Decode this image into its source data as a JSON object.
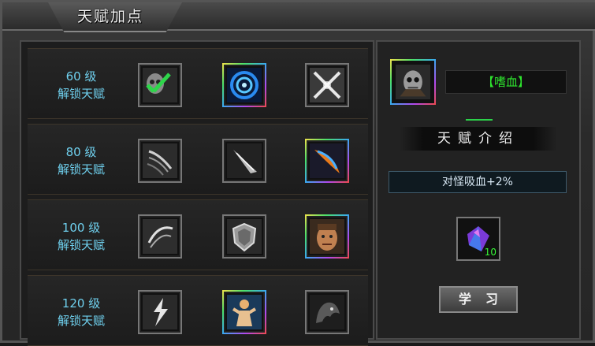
{
  "window": {
    "title": "天赋加点"
  },
  "rows": [
    {
      "line1": "60 级",
      "line2": "解锁天赋",
      "slots": [
        {
          "icon": "skull-checkmark-icon",
          "frame": "gray",
          "selected": true
        },
        {
          "icon": "blue-vortex-icon",
          "frame": "rainbow"
        },
        {
          "icon": "crossed-swords-icon",
          "frame": "gray"
        }
      ]
    },
    {
      "line1": "80 级",
      "line2": "解锁天赋",
      "slots": [
        {
          "icon": "slashing-blade-icon",
          "frame": "gray"
        },
        {
          "icon": "spiked-drill-icon",
          "frame": "gray"
        },
        {
          "icon": "flaming-scimitar-icon",
          "frame": "rainbow"
        }
      ]
    },
    {
      "line1": "100 级",
      "line2": "解锁天赋",
      "slots": [
        {
          "icon": "wind-slash-icon",
          "frame": "gray"
        },
        {
          "icon": "shield-icon",
          "frame": "gray"
        },
        {
          "icon": "warrior-face-icon",
          "frame": "rainbow"
        }
      ]
    },
    {
      "line1": "120 级",
      "line2": "解锁天赋",
      "slots": [
        {
          "icon": "lightning-icon",
          "frame": "gray"
        },
        {
          "icon": "fighter-figure-icon",
          "frame": "rainbow"
        },
        {
          "icon": "dark-beast-icon",
          "frame": "gray"
        }
      ]
    }
  ],
  "detail": {
    "portrait_icon": "skull-warrior-icon",
    "talent_name": "【嗜血】",
    "intro_title": "天赋介绍",
    "description": "对怪吸血+2%",
    "cost_icon": "purple-gem-icon",
    "cost_count": "10",
    "learn_label": "学习"
  },
  "colors": {
    "label_cyan": "#6fd0ee",
    "name_green": "#2ee62e",
    "count_green": "#3cff3c"
  }
}
